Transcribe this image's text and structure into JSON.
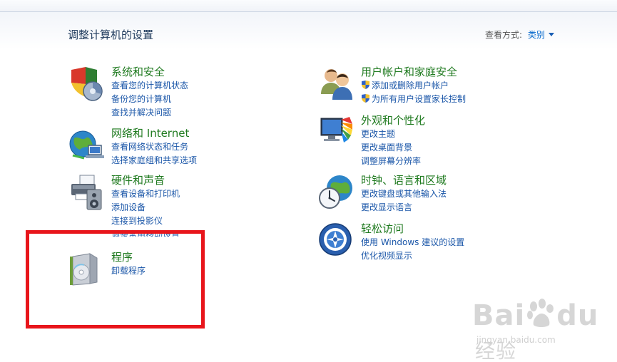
{
  "header": {
    "title": "调整计算机的设置",
    "view_by_label": "查看方式:",
    "view_by_value": "类别"
  },
  "left": [
    {
      "title": "系统和安全",
      "links": [
        "查看您的计算机状态",
        "备份您的计算机",
        "查找并解决问题"
      ]
    },
    {
      "title": "网络和 Internet",
      "links": [
        "查看网络状态和任务",
        "选择家庭组和共享选项"
      ]
    },
    {
      "title": "硬件和声音",
      "links": [
        "查看设备和打印机",
        "添加设备",
        "连接到投影仪",
        "调整常用移动设置"
      ]
    },
    {
      "title": "程序",
      "links": [
        "卸载程序"
      ]
    }
  ],
  "right": [
    {
      "title": "用户帐户和家庭安全",
      "links": [
        "添加或删除用户帐户",
        "为所有用户设置家长控制"
      ]
    },
    {
      "title": "外观和个性化",
      "links": [
        "更改主题",
        "更改桌面背景",
        "调整屏幕分辨率"
      ]
    },
    {
      "title": "时钟、语言和区域",
      "links": [
        "更改键盘或其他输入法",
        "更改显示语言"
      ]
    },
    {
      "title": "轻松访问",
      "links": [
        "使用 Windows 建议的设置",
        "优化视频显示"
      ]
    }
  ],
  "watermark": {
    "brand": "Bai",
    "brand2": "du",
    "jingyan": "经验",
    "url": "jingyan.baidu.com"
  },
  "colors": {
    "title": "#1e395b",
    "category": "#1f7a1f",
    "link": "#1a56a8",
    "highlight": "#e8151b"
  }
}
